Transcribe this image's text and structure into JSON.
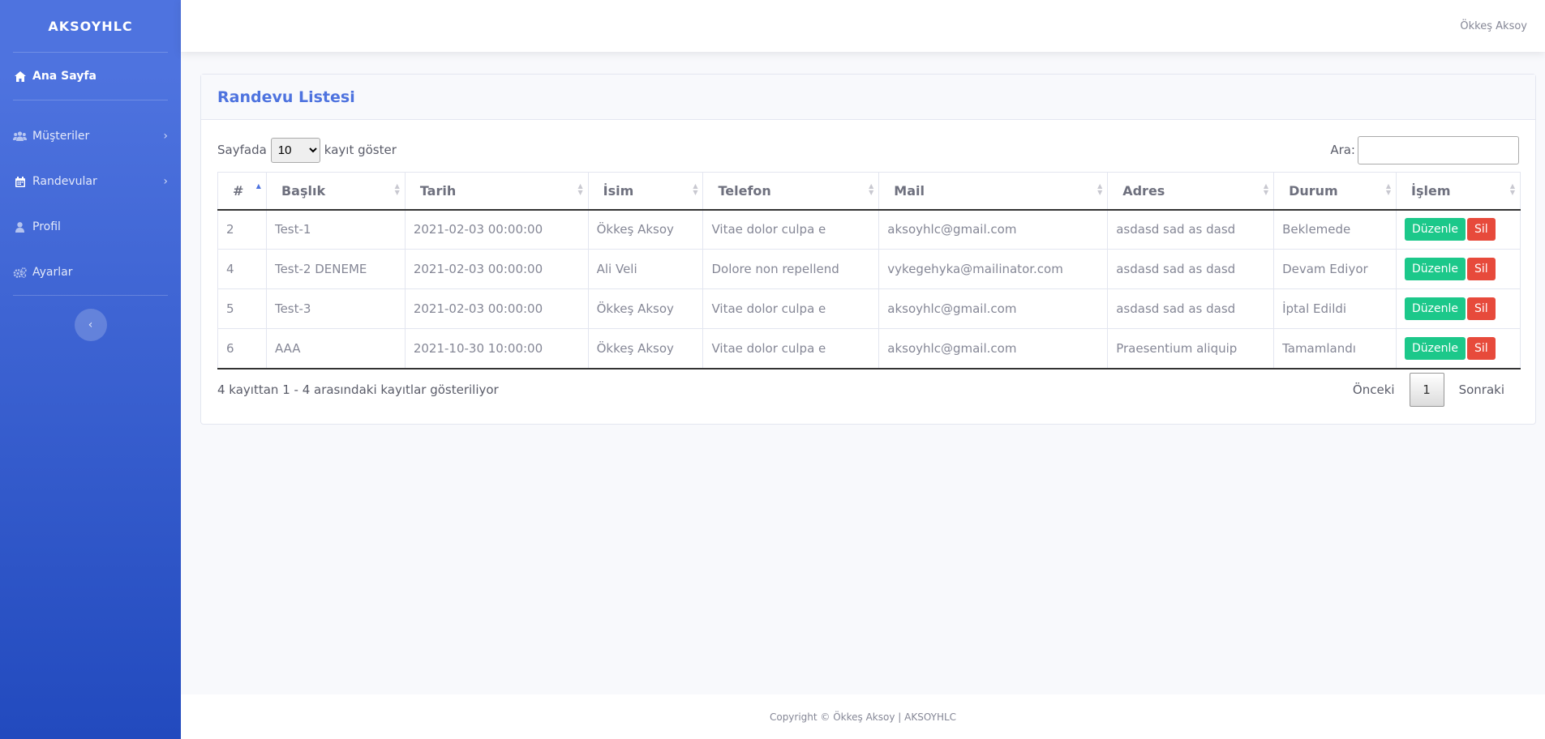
{
  "brand": "AKSOYHLC",
  "sidebar": {
    "items": [
      {
        "label": "Ana Sayfa",
        "icon": "home-icon"
      },
      {
        "label": "Müşteriler",
        "icon": "users-icon"
      },
      {
        "label": "Randevular",
        "icon": "calendar-icon"
      },
      {
        "label": "Profil",
        "icon": "user-icon"
      },
      {
        "label": "Ayarlar",
        "icon": "cogs-icon"
      }
    ],
    "toggle_icon": "chevron-left-icon"
  },
  "topbar": {
    "user_name": "Ökkeş Aksoy"
  },
  "card": {
    "title": "Randevu Listesi"
  },
  "controls": {
    "length_prefix": "Sayfada",
    "length_value": "10",
    "length_suffix": "kayıt göster",
    "search_label": "Ara:",
    "search_value": ""
  },
  "table": {
    "headers": [
      "#",
      "Başlık",
      "Tarih",
      "İsim",
      "Telefon",
      "Mail",
      "Adres",
      "Durum",
      "İşlem"
    ],
    "rows": [
      [
        "2",
        "Test-1",
        "2021-02-03 00:00:00",
        "Ökkeş Aksoy",
        "Vitae dolor culpa e",
        "aksoyhlc@gmail.com",
        "asdasd sad as dasd",
        "Beklemede"
      ],
      [
        "4",
        "Test-2 DENEME",
        "2021-02-03 00:00:00",
        "Ali Veli",
        "Dolore non repellend",
        "vykegehyka@mailinator.com",
        "asdasd sad as dasd",
        "Devam Ediyor"
      ],
      [
        "5",
        "Test-3",
        "2021-02-03 00:00:00",
        "Ökkeş Aksoy",
        "Vitae dolor culpa e",
        "aksoyhlc@gmail.com",
        "asdasd sad as dasd",
        "İptal Edildi"
      ],
      [
        "6",
        "AAA",
        "2021-10-30 10:00:00",
        "Ökkeş Aksoy",
        "Vitae dolor culpa e",
        "aksoyhlc@gmail.com",
        "Praesentium aliquip",
        "Tamamlandı"
      ]
    ],
    "edit_label": "Düzenle",
    "delete_label": "Sil"
  },
  "info": "4 kayıttan 1 - 4 arasındaki kayıtlar gösteriliyor",
  "pagination": {
    "prev": "Önceki",
    "current": "1",
    "next": "Sonraki"
  },
  "footer": "Copyright © Ökkeş Aksoy | AKSOYHLC",
  "colors": {
    "primary": "#4e73df",
    "success": "#1cc88a",
    "danger": "#e74a3b"
  }
}
